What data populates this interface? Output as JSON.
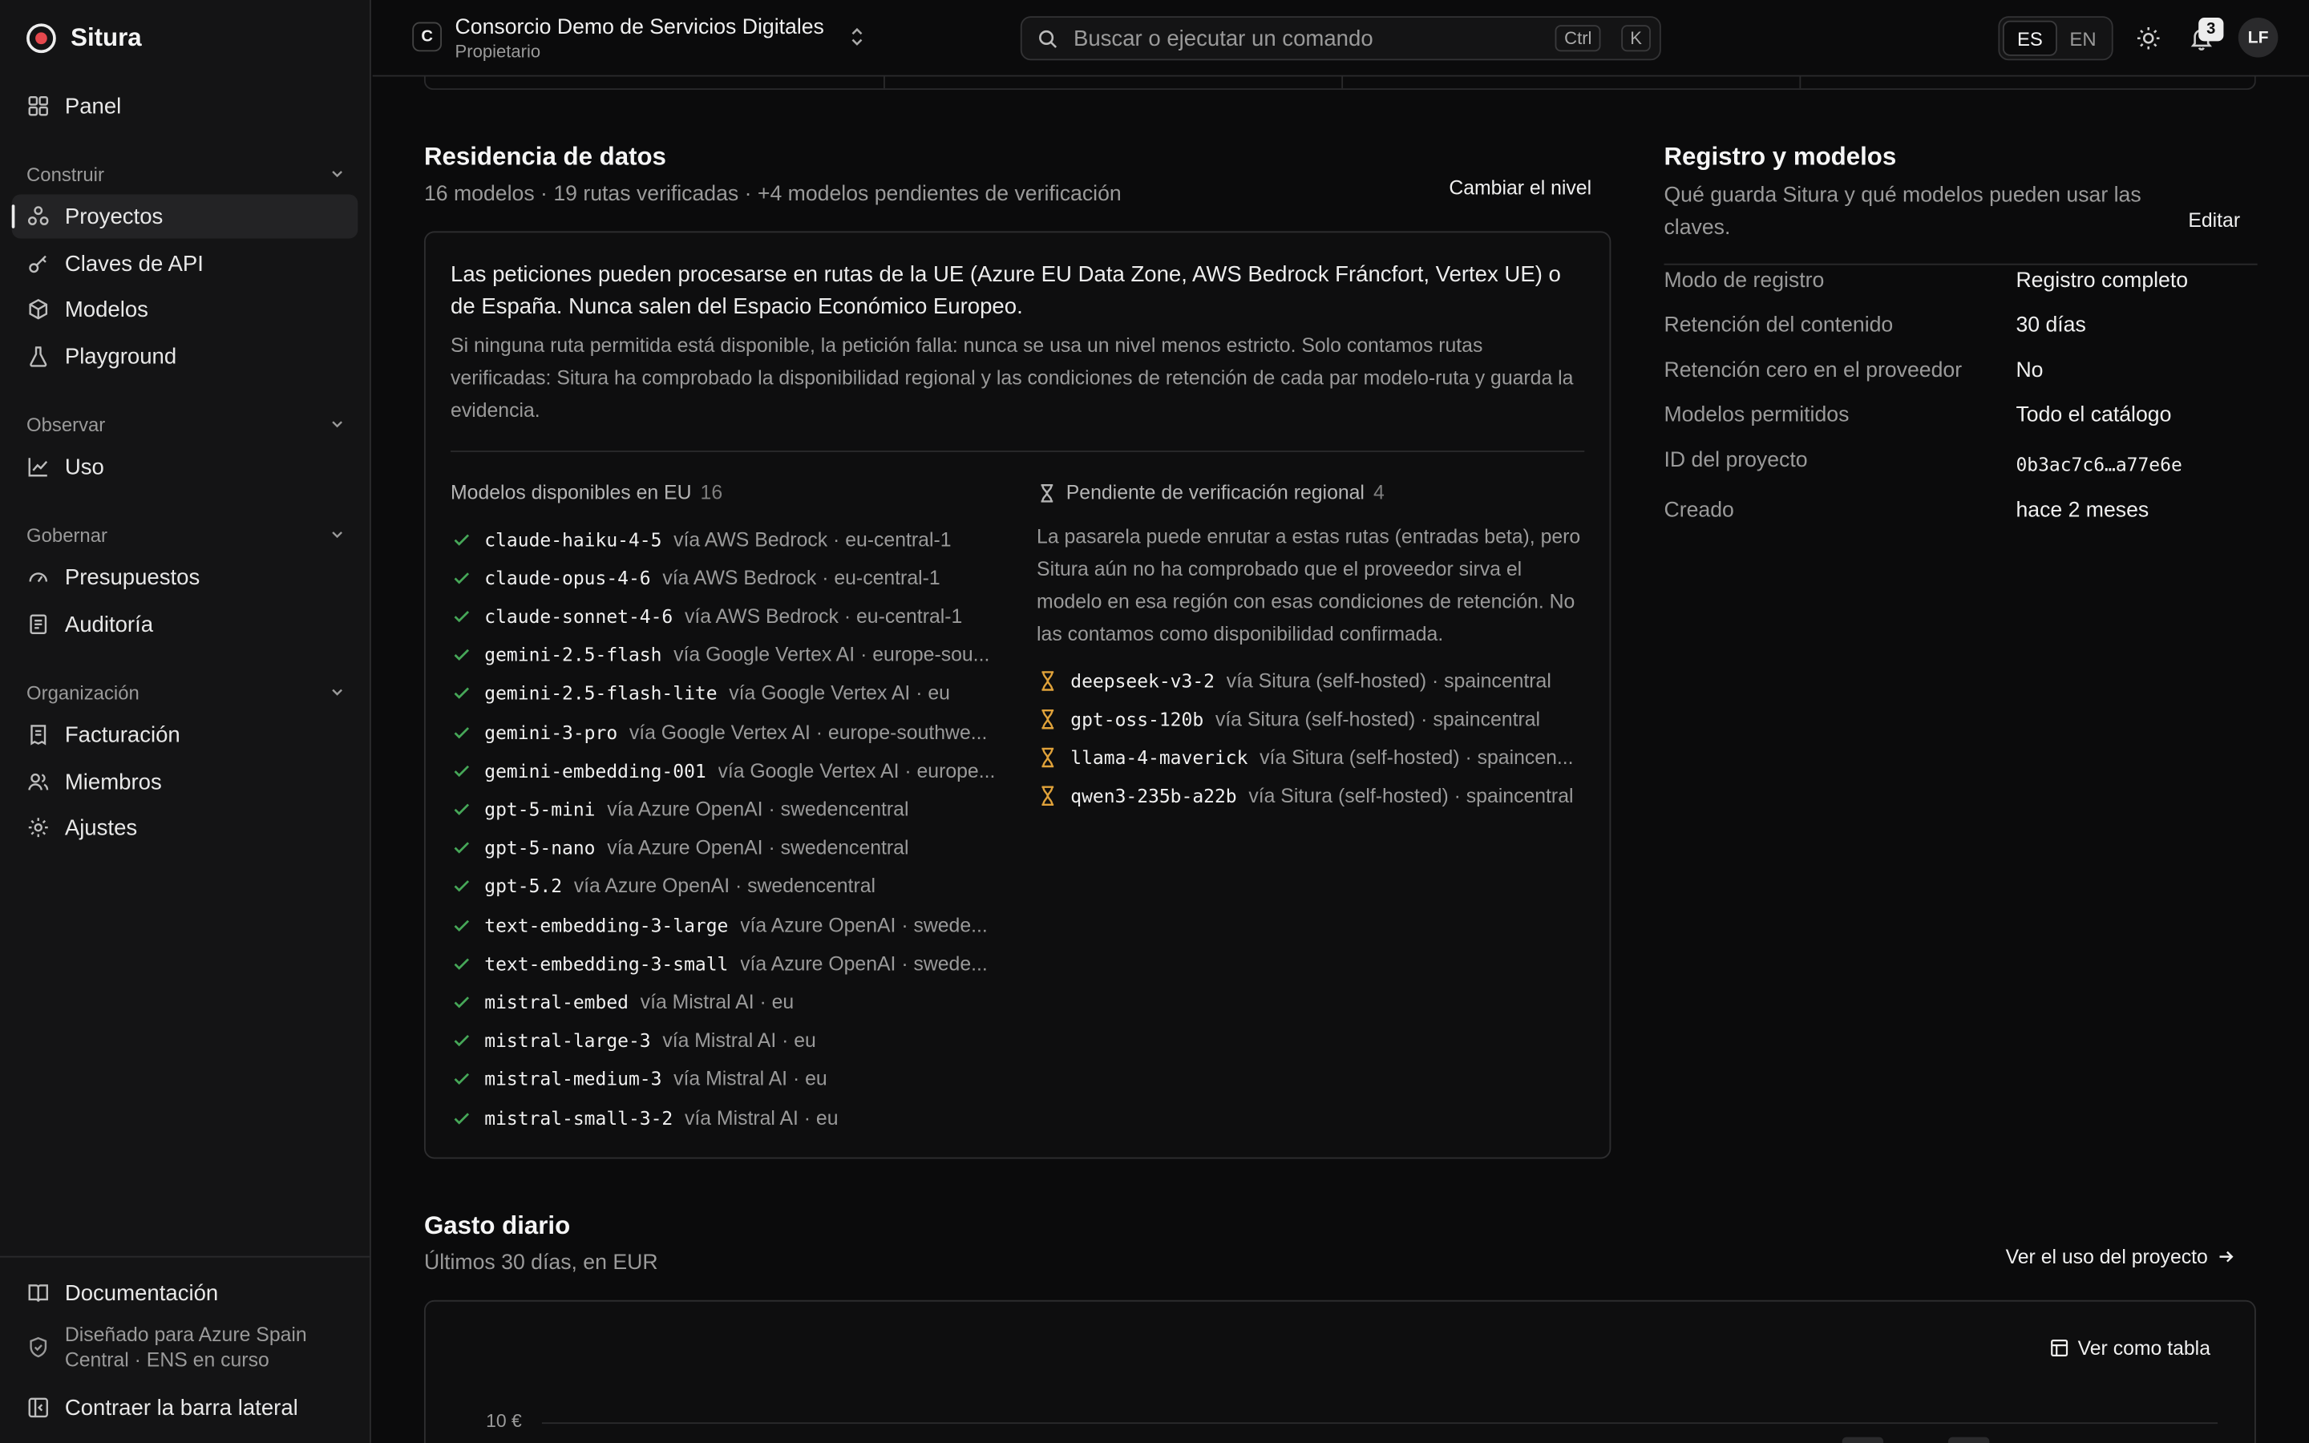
{
  "brand": {
    "name": "Situra"
  },
  "sidebar": {
    "panel": "Panel",
    "sections": [
      {
        "title": "Construir",
        "items": [
          "Proyectos",
          "Claves de API",
          "Modelos",
          "Playground"
        ]
      },
      {
        "title": "Observar",
        "items": [
          "Uso"
        ]
      },
      {
        "title": "Gobernar",
        "items": [
          "Presupuestos",
          "Auditoría"
        ]
      },
      {
        "title": "Organización",
        "items": [
          "Facturación",
          "Miembros",
          "Ajustes"
        ]
      }
    ],
    "active_item": "Proyectos",
    "docs": "Documentación",
    "footnote": "Diseñado para Azure Spain Central · ENS en curso",
    "collapse": "Contraer la barra lateral"
  },
  "topbar": {
    "org_initial": "C",
    "org_name": "Consorcio Demo de Servicios Digitales",
    "org_role": "Propietario",
    "search_placeholder": "Buscar o ejecutar un comando",
    "kbd_ctrl": "Ctrl",
    "kbd_k": "K",
    "lang_es": "ES",
    "lang_en": "EN",
    "lang_selected": "ES",
    "notifications": "3",
    "avatar": "LF"
  },
  "residency": {
    "title": "Residencia de datos",
    "subtitle": "16 modelos · 19 rutas verificadas · +4 modelos pendientes de verificación",
    "action": "Cambiar el nivel",
    "lead": "Las peticiones pueden procesarse en rutas de la UE (Azure EU Data Zone, AWS Bedrock Fráncfort, Vertex UE) o de España. Nunca salen del Espacio Económico Europeo.",
    "note": "Si ninguna ruta permitida está disponible, la petición falla: nunca se usa un nivel menos estricto. Solo contamos rutas verificadas: Situra ha comprobado la disponibilidad regional y las condiciones de retención de cada par modelo-ruta y guarda la evidencia.",
    "available_title": "Modelos disponibles en EU",
    "available_count": "16",
    "available": [
      {
        "model": "claude-haiku-4-5",
        "route": "vía AWS Bedrock · eu-central-1"
      },
      {
        "model": "claude-opus-4-6",
        "route": "vía AWS Bedrock · eu-central-1"
      },
      {
        "model": "claude-sonnet-4-6",
        "route": "vía AWS Bedrock · eu-central-1"
      },
      {
        "model": "gemini-2.5-flash",
        "route": "vía Google Vertex AI · europe-sou..."
      },
      {
        "model": "gemini-2.5-flash-lite",
        "route": "vía Google Vertex AI · eu"
      },
      {
        "model": "gemini-3-pro",
        "route": "vía Google Vertex AI · europe-southwe..."
      },
      {
        "model": "gemini-embedding-001",
        "route": "vía Google Vertex AI · europe..."
      },
      {
        "model": "gpt-5-mini",
        "route": "vía Azure OpenAI · swedencentral"
      },
      {
        "model": "gpt-5-nano",
        "route": "vía Azure OpenAI · swedencentral"
      },
      {
        "model": "gpt-5.2",
        "route": "vía Azure OpenAI · swedencentral"
      },
      {
        "model": "text-embedding-3-large",
        "route": "vía Azure OpenAI · swede..."
      },
      {
        "model": "text-embedding-3-small",
        "route": "vía Azure OpenAI · swede..."
      },
      {
        "model": "mistral-embed",
        "route": "vía Mistral AI · eu"
      },
      {
        "model": "mistral-large-3",
        "route": "vía Mistral AI · eu"
      },
      {
        "model": "mistral-medium-3",
        "route": "vía Mistral AI · eu"
      },
      {
        "model": "mistral-small-3-2",
        "route": "vía Mistral AI · eu"
      }
    ],
    "pending_title": "Pendiente de verificación regional",
    "pending_count": "4",
    "pending_desc": "La pasarela puede enrutar a estas rutas (entradas beta), pero Situra aún no ha comprobado que el proveedor sirva el modelo en esa región con esas condiciones de retención. No las contamos como disponibilidad confirmada.",
    "pending": [
      {
        "model": "deepseek-v3-2",
        "route": "vía Situra (self-hosted) · spaincentral"
      },
      {
        "model": "gpt-oss-120b",
        "route": "vía Situra (self-hosted) · spaincentral"
      },
      {
        "model": "llama-4-maverick",
        "route": "vía Situra (self-hosted) · spaincen..."
      },
      {
        "model": "qwen3-235b-a22b",
        "route": "vía Situra (self-hosted) · spaincentral"
      }
    ]
  },
  "registry": {
    "title": "Registro y modelos",
    "desc": "Qué guarda Situra y qué modelos pueden usar las claves.",
    "action": "Editar",
    "rows": [
      {
        "k": "Modo de registro",
        "v": "Registro completo"
      },
      {
        "k": "Retención del contenido",
        "v": "30 días"
      },
      {
        "k": "Retención cero en el proveedor",
        "v": "No"
      },
      {
        "k": "Modelos permitidos",
        "v": "Todo el catálogo"
      },
      {
        "k": "ID del proyecto",
        "v": "0b3ac7c6…a77e6e"
      },
      {
        "k": "Creado",
        "v": "hace 2 meses"
      }
    ]
  },
  "spend": {
    "title": "Gasto diario",
    "subtitle": "Últimos 30 días, en EUR",
    "link": "Ver el uso del proyecto",
    "table_toggle": "Ver como tabla",
    "y_tick": "10 €"
  }
}
